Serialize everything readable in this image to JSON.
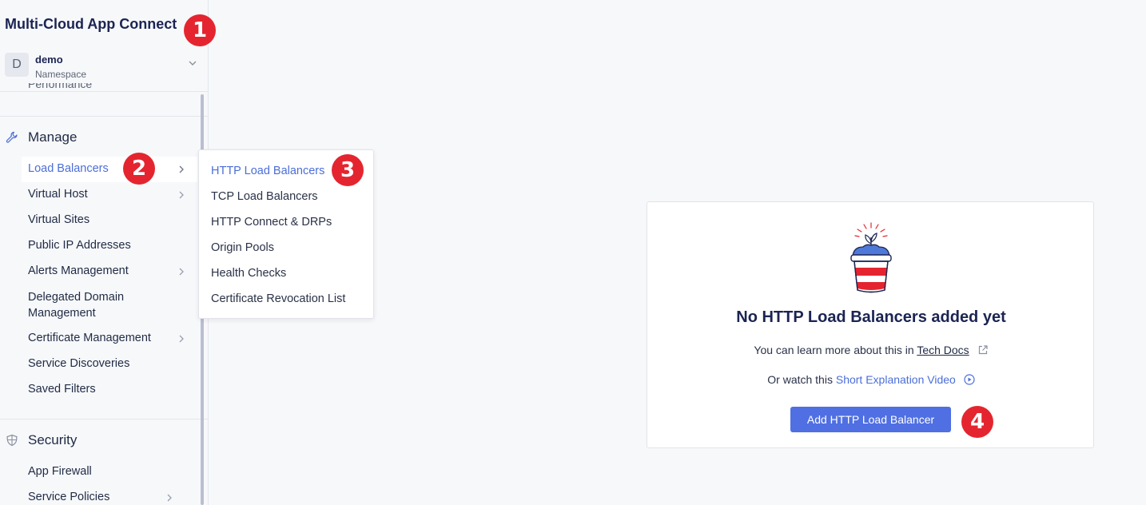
{
  "app": {
    "title": "Multi-Cloud App Connect"
  },
  "namespace": {
    "avatar_letter": "D",
    "name": "demo",
    "label": "Namespace"
  },
  "sidebar": {
    "cut_item": "Performance",
    "manage": {
      "label": "Manage",
      "items": [
        {
          "label": "Load Balancers",
          "has_submenu": true,
          "active": true
        },
        {
          "label": "Virtual Host",
          "has_submenu": true
        },
        {
          "label": "Virtual Sites",
          "has_submenu": false
        },
        {
          "label": "Public IP Addresses",
          "has_submenu": false
        },
        {
          "label": "Alerts Management",
          "has_submenu": true
        },
        {
          "label_line1": "Delegated Domain",
          "label_line2": "Management",
          "has_submenu": false
        },
        {
          "label": "Certificate Management",
          "has_submenu": true
        },
        {
          "label": "Service Discoveries",
          "has_submenu": false
        },
        {
          "label": "Saved Filters",
          "has_submenu": false
        }
      ]
    },
    "security": {
      "label": "Security",
      "items": [
        {
          "label": "App Firewall",
          "has_submenu": false
        },
        {
          "label": "Service Policies",
          "has_submenu": true
        }
      ]
    }
  },
  "flyout": {
    "items": [
      {
        "label": "HTTP Load Balancers",
        "active": true
      },
      {
        "label": "TCP Load Balancers"
      },
      {
        "label": "HTTP Connect & DRPs"
      },
      {
        "label": "Origin Pools"
      },
      {
        "label": "Health Checks"
      },
      {
        "label": "Certificate Revocation List"
      }
    ]
  },
  "empty_state": {
    "title": "No HTTP Load Balancers added yet",
    "learn_prefix": "You can learn more about this in",
    "learn_link": "Tech Docs",
    "watch_prefix": "Or watch this",
    "watch_link": "Short Explanation Video",
    "button": "Add HTTP Load Balancer"
  },
  "callouts": [
    "1",
    "2",
    "3",
    "4"
  ],
  "colors": {
    "accent": "#4f6fe3",
    "link": "#4b6ed8",
    "callout": "#e4252f",
    "title": "#1b2452"
  },
  "icons": {
    "manage": "wrench-icon",
    "security": "shield-icon",
    "namespace": "chevron-down-icon",
    "submenu": "chevron-right-icon",
    "tech_docs": "external-link-icon",
    "video": "play-circle-icon",
    "empty": "plant-pot-illustration"
  }
}
